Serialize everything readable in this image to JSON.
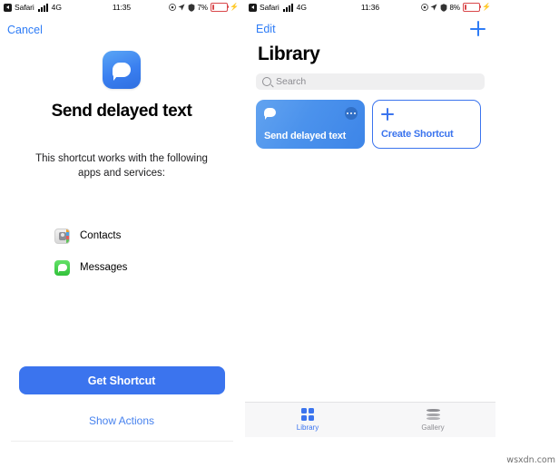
{
  "left_screen": {
    "status_bar": {
      "back_app": "Safari",
      "network": "4G",
      "time": "11:35",
      "battery_percent": "7%",
      "icons": [
        "back-arrow-icon",
        "signal-bars-icon",
        "location-arrow-icon",
        "lock-rotation-icon",
        "battery-icon",
        "charging-bolt-icon"
      ]
    },
    "nav": {
      "cancel_label": "Cancel"
    },
    "hero": {
      "icon": "message-bubble-icon",
      "title": "Send delayed text",
      "description": "This shortcut works with the following apps and services:"
    },
    "apps": [
      {
        "name": "Contacts",
        "icon": "contacts-app-icon"
      },
      {
        "name": "Messages",
        "icon": "messages-app-icon"
      }
    ],
    "footer": {
      "primary_label": "Get Shortcut",
      "secondary_label": "Show Actions"
    }
  },
  "right_screen": {
    "status_bar": {
      "back_app": "Safari",
      "network": "4G",
      "time": "11:36",
      "battery_percent": "8%",
      "icons": [
        "back-arrow-icon",
        "signal-bars-icon",
        "location-arrow-icon",
        "lock-rotation-icon",
        "battery-icon",
        "charging-bolt-icon"
      ]
    },
    "nav": {
      "edit_label": "Edit",
      "add_icon": "plus-icon"
    },
    "page_title": "Library",
    "search": {
      "placeholder": "Search",
      "icon": "search-icon"
    },
    "cards": [
      {
        "title": "Send delayed text",
        "icon": "message-bubble-icon",
        "more_icon": "ellipsis-icon",
        "type": "shortcut"
      },
      {
        "title": "Create Shortcut",
        "icon": "plus-icon",
        "type": "create"
      }
    ],
    "tabs": [
      {
        "label": "Library",
        "icon": "grid-icon",
        "active": true
      },
      {
        "label": "Gallery",
        "icon": "stack-icon",
        "active": false
      }
    ]
  },
  "watermark": "wsxdn.com",
  "colors": {
    "accent_blue": "#3b74ee",
    "link_blue": "#2e7cf6",
    "inactive_gray": "#8e8e93",
    "battery_red": "#d9474a",
    "messages_green": "#32c23a"
  }
}
